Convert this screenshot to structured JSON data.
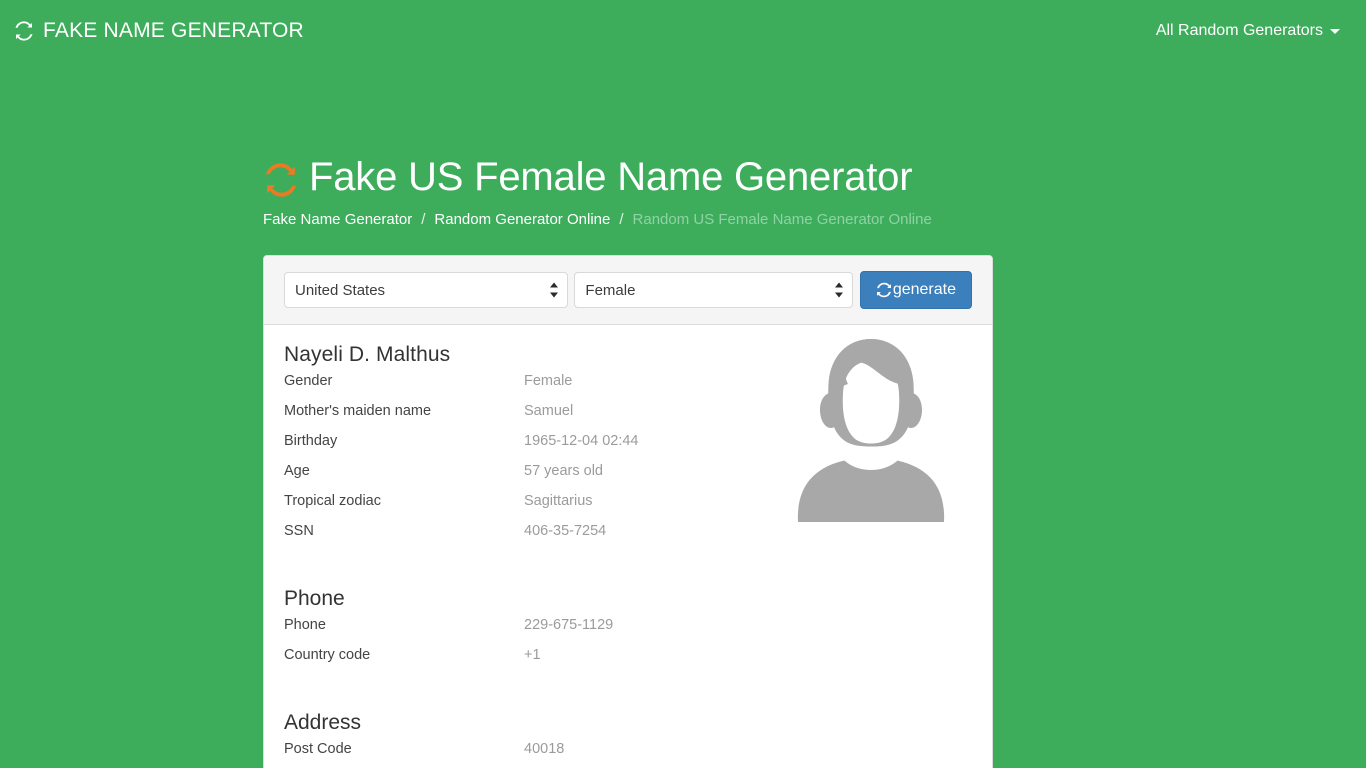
{
  "navbar": {
    "brand_icon": "refresh-icon",
    "brand": "FAKE NAME GENERATOR",
    "menu_label": "All Random Generators",
    "caret_icon": "chevron-down-icon"
  },
  "header": {
    "title_icon": "refresh-icon",
    "title": "Fake US Female Name Generator",
    "breadcrumb": {
      "item1": "Fake Name Generator",
      "sep1": "/",
      "item2": "Random Generator Online",
      "sep2": "/",
      "active": "Random US Female Name Generator Online"
    }
  },
  "form": {
    "country_value": "United States",
    "gender_value": "Female",
    "generate_icon": "refresh-icon",
    "generate_label": "generate"
  },
  "person": {
    "name": "Nayeli D. Malthus",
    "fields": [
      {
        "label": "Gender",
        "value": "Female"
      },
      {
        "label": "Mother's maiden name",
        "value": "Samuel"
      },
      {
        "label": "Birthday",
        "value": "1965-12-04 02:44"
      },
      {
        "label": "Age",
        "value": "57 years old"
      },
      {
        "label": "Tropical zodiac",
        "value": "Sagittarius"
      },
      {
        "label": "SSN",
        "value": "406-35-7254"
      }
    ],
    "avatar_icon": "female-avatar-placeholder"
  },
  "phone": {
    "title": "Phone",
    "fields": [
      {
        "label": "Phone",
        "value": "229-675-1129"
      },
      {
        "label": "Country code",
        "value": "+1"
      }
    ]
  },
  "address": {
    "title": "Address",
    "fields": [
      {
        "label": "Post Code",
        "value": "40018"
      }
    ]
  },
  "colors": {
    "page_background": "#3dad5c",
    "button_primary": "#3b7fbc",
    "title_icon": "#ea7a23",
    "breadcrumb_active": "#8fd3a4",
    "value_text": "#9b9b9b",
    "avatar_gray": "#a8a8a8"
  }
}
